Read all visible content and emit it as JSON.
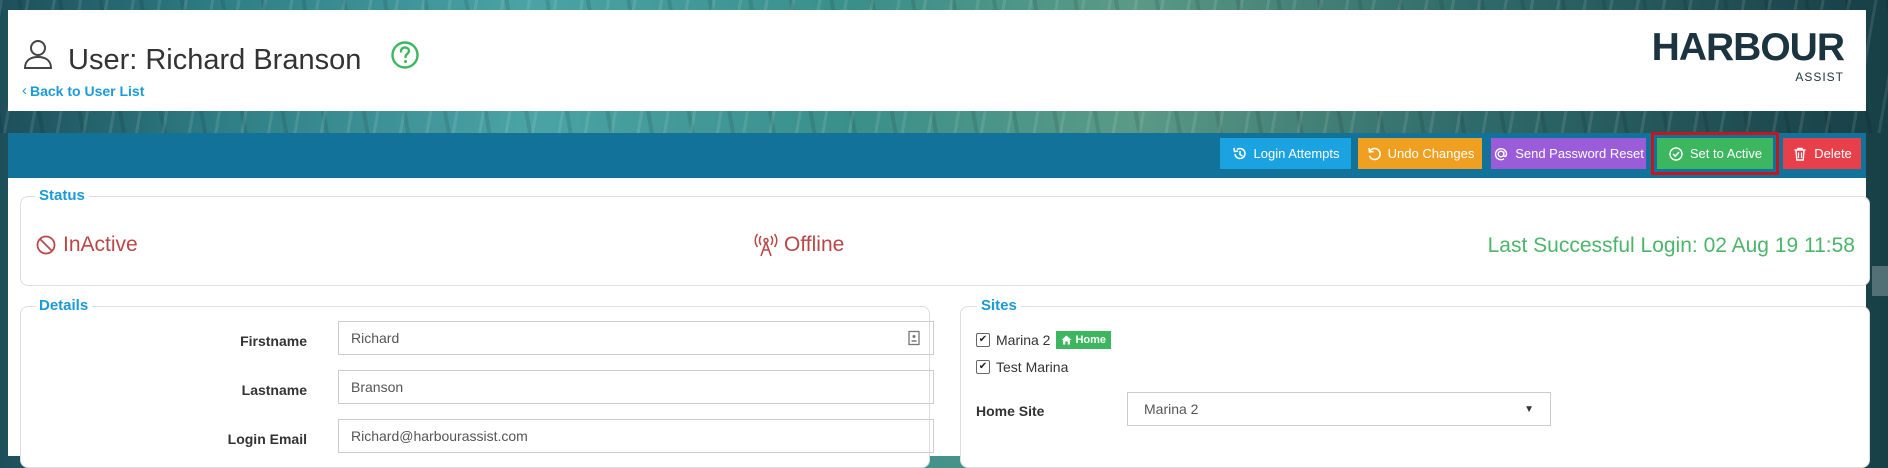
{
  "header": {
    "title": "User: Richard Branson",
    "back_link": "Back to User List",
    "logo_text": "HARBOUR",
    "logo_sub": "ASSIST"
  },
  "toolbar": {
    "login_attempts": "Login Attempts",
    "undo_changes": "Undo Changes",
    "send_password_reset": "Send Password Reset",
    "set_to_active": "Set to Active",
    "delete": "Delete"
  },
  "status": {
    "title": "Status",
    "state": "InActive",
    "connection": "Offline",
    "last_login": "Last Successful Login: 02 Aug 19 11:58"
  },
  "details": {
    "title": "Details",
    "firstname_label": "Firstname",
    "firstname_value": "Richard",
    "lastname_label": "Lastname",
    "lastname_value": "Branson",
    "email_label": "Login Email",
    "email_value": "Richard@harbourassist.com"
  },
  "sites": {
    "title": "Sites",
    "items": [
      {
        "name": "Marina 2",
        "checked": true,
        "badge": "Home"
      },
      {
        "name": "Test Marina",
        "checked": true
      }
    ],
    "home_site_label": "Home Site",
    "home_site_value": "Marina 2"
  },
  "colors": {
    "accent": "#1a9bd8",
    "toolbar": "#137299",
    "login_btn": "#1aa3e0",
    "undo_btn": "#f0a020",
    "reset_btn": "#9a5cd8",
    "active_btn": "#3cb760",
    "delete_btn": "#e8404a",
    "inactive": "#b84848",
    "last_login": "#4cb56a"
  },
  "icons": {
    "user": "user-icon",
    "help": "help-circle-icon",
    "history": "history-icon",
    "undo": "undo-icon",
    "at": "at-icon",
    "check_circle": "check-circle-icon",
    "trash": "trash-icon",
    "ban": "ban-icon",
    "tower": "broadcast-tower-icon",
    "contact_card": "contact-card-icon",
    "home": "home-icon"
  }
}
